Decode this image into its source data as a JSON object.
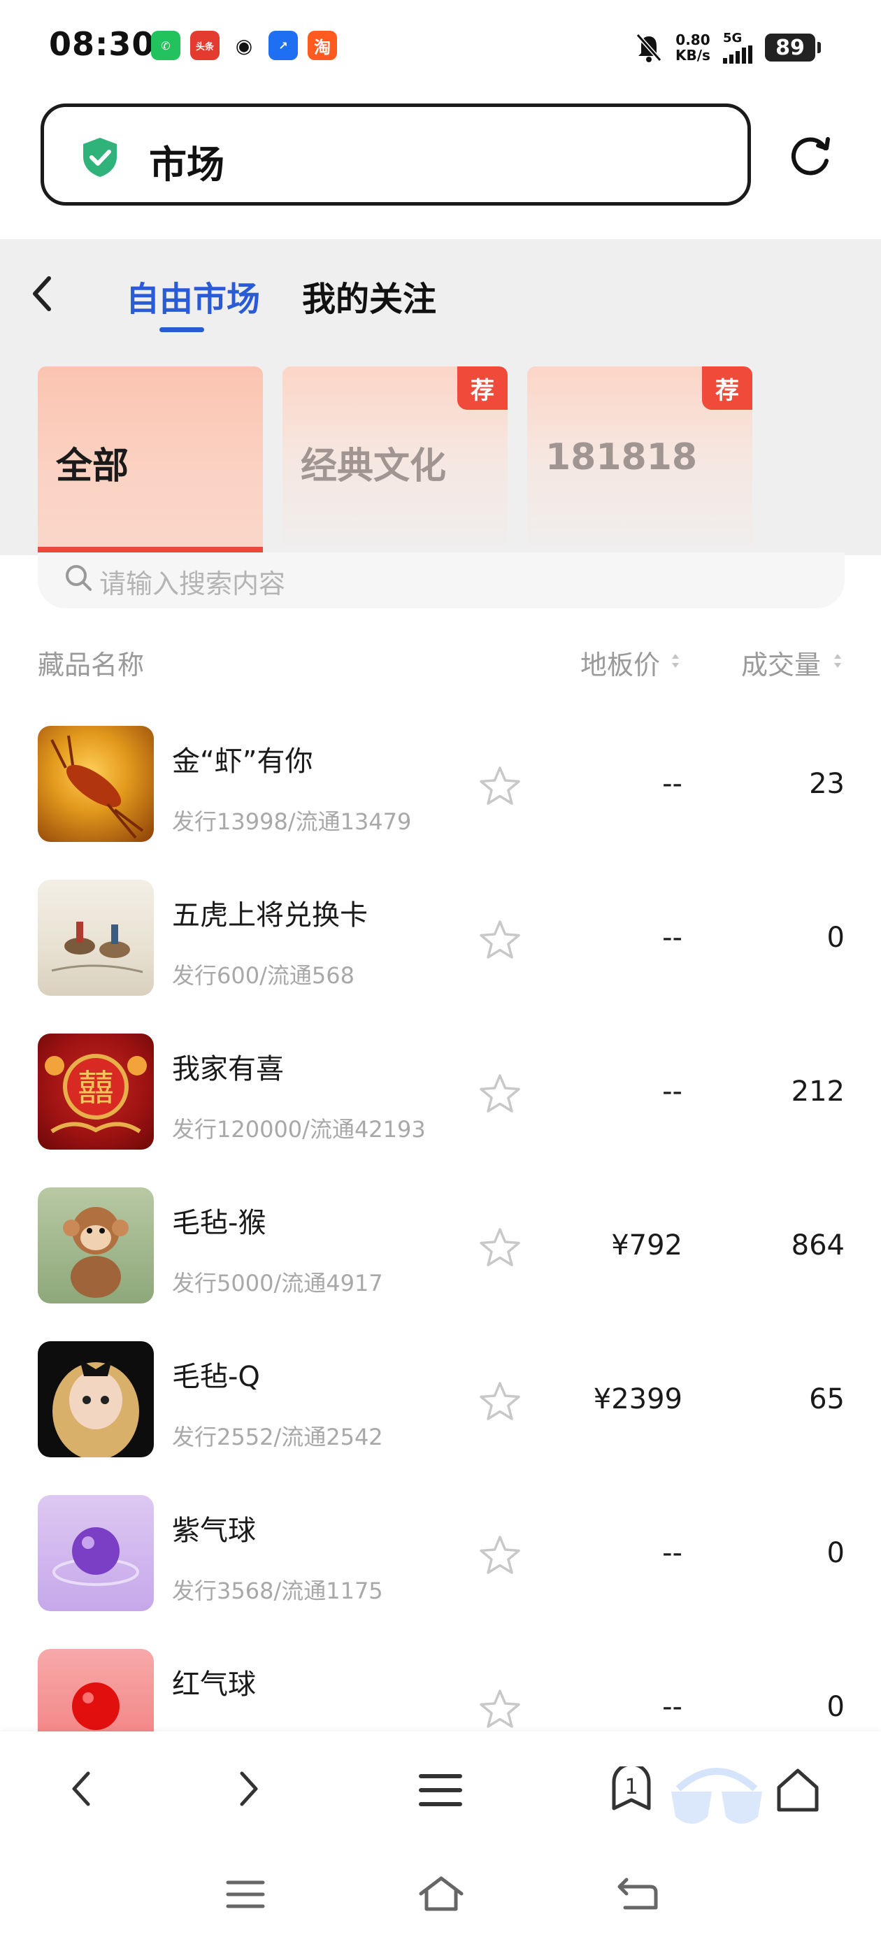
{
  "status_bar": {
    "time": "08:30",
    "app_icons": [
      {
        "name": "wechat-icon",
        "color": "#22c35e",
        "glyph": "✆"
      },
      {
        "name": "toutiao-icon",
        "color": "#e33b2f",
        "glyph": "头条"
      },
      {
        "name": "qq-icon",
        "color": "#222222",
        "glyph": "🐧"
      },
      {
        "name": "app-icon",
        "color": "#1e6ff2",
        "glyph": "↗"
      },
      {
        "name": "taobao-icon",
        "color": "#ff5a1f",
        "glyph": "淘"
      }
    ],
    "net_speed_value": "0.80",
    "net_speed_unit": "KB/s",
    "signal_label": "5G",
    "battery": "89"
  },
  "url_bar": {
    "text": "市场"
  },
  "tabs": {
    "free_market": "自由市场",
    "my_follow": "我的关注"
  },
  "categories": [
    {
      "label": "全部",
      "recommended": false,
      "badge": ""
    },
    {
      "label": "经典文化",
      "recommended": true,
      "badge": "荐"
    },
    {
      "label": "181818",
      "recommended": true,
      "badge": "荐"
    }
  ],
  "search": {
    "placeholder": "请输入搜索内容"
  },
  "columns": {
    "name": "藏品名称",
    "floor_price": "地板价",
    "volume": "成交量"
  },
  "items": [
    {
      "name": "金“虾”有你",
      "supply": "发行13998/流通13479",
      "price": "--",
      "volume": "23",
      "thumb": "lobster"
    },
    {
      "name": "五虎上将兑换卡",
      "supply": "发行600/流通568",
      "price": "--",
      "volume": "0",
      "thumb": "painting"
    },
    {
      "name": "我家有喜",
      "supply": "发行120000/流通42193",
      "price": "--",
      "volume": "212",
      "thumb": "xi"
    },
    {
      "name": "毛毡-猴",
      "supply": "发行5000/流通4917",
      "price": "¥792",
      "volume": "864",
      "thumb": "monkey"
    },
    {
      "name": "毛毡-Q",
      "supply": "发行2552/流通2542",
      "price": "¥2399",
      "volume": "65",
      "thumb": "doll"
    },
    {
      "name": "紫气球",
      "supply": "发行3568/流通1175",
      "price": "--",
      "volume": "0",
      "thumb": "purple"
    },
    {
      "name": "红气球",
      "supply": "",
      "price": "--",
      "volume": "0",
      "thumb": "red"
    }
  ],
  "bottom_bar": {
    "tab_count": "1"
  },
  "colors": {
    "accent": "#2a5bd7",
    "badge": "#ef4a3a"
  }
}
